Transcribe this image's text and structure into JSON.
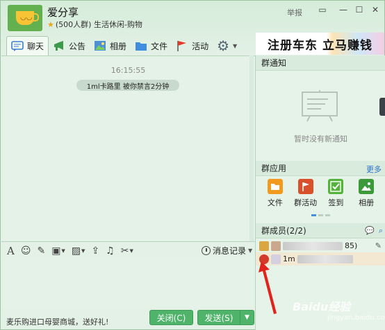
{
  "window": {
    "title": "爱分享",
    "subtitle": "(500人群) 生活休闲-购物",
    "report_label": "举报",
    "controls": [
      "▭",
      "—",
      "☐",
      "✕"
    ]
  },
  "toolbar": {
    "tabs": [
      {
        "label": "聊天",
        "icon": "chat-icon"
      },
      {
        "label": "公告",
        "icon": "megaphone-icon"
      },
      {
        "label": "相册",
        "icon": "photo-icon"
      },
      {
        "label": "文件",
        "icon": "folder-icon"
      },
      {
        "label": "活动",
        "icon": "flag-icon"
      }
    ]
  },
  "banner": {
    "text": "注册车东 立马赚钱"
  },
  "chat": {
    "timestamp": "16:15:55",
    "system_message": "1ml卡路里 被你禁言2分钟"
  },
  "input_toolbar": {
    "history_label": "消息记录"
  },
  "footer": {
    "ad_text": "麦乐购进口母婴商城，送好礼!",
    "close_label": "关闭(C)",
    "send_label": "发送(S)"
  },
  "right_panel": {
    "notice_header": "群通知",
    "notice_empty": "暂时没有新通知",
    "apps_header": "群应用",
    "apps_more": "更多",
    "apps": [
      {
        "label": "文件",
        "color": "#f29a1f"
      },
      {
        "label": "群活动",
        "color": "#d9502b"
      },
      {
        "label": "签到",
        "color": "#53b33a"
      },
      {
        "label": "相册",
        "color": "#3d9a3a"
      }
    ],
    "members_header": "群成员(2/2)",
    "members": [
      {
        "suffix": "85)"
      },
      {
        "prefix": "1m"
      }
    ]
  },
  "watermark": {
    "text": "Baidu经验",
    "sub": "jingyan.baidu.com"
  }
}
